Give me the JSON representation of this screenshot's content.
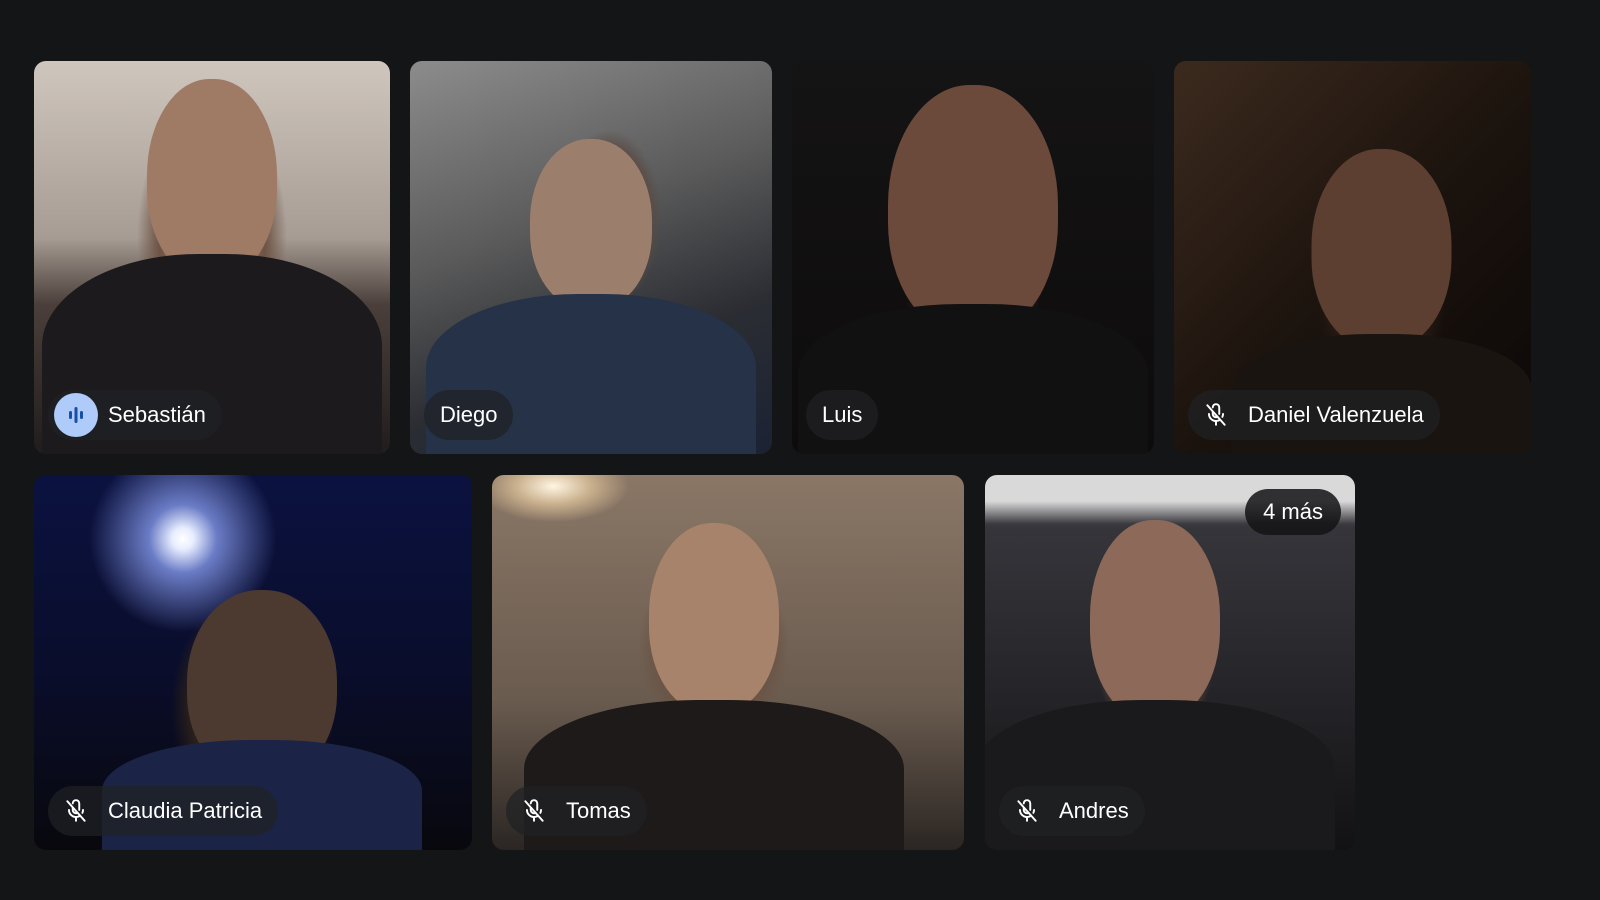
{
  "meeting": {
    "participants": [
      {
        "name": "Sebastián",
        "mic": "speaking",
        "icon": "audio-wave-icon"
      },
      {
        "name": "Diego",
        "mic": "none"
      },
      {
        "name": "Luis",
        "mic": "none"
      },
      {
        "name": "Daniel Valenzuela",
        "mic": "muted",
        "icon": "mic-off-icon"
      },
      {
        "name": "Claudia Patricia",
        "mic": "muted",
        "icon": "mic-off-icon"
      },
      {
        "name": "Tomas",
        "mic": "muted",
        "icon": "mic-off-icon"
      },
      {
        "name": "Andres",
        "mic": "muted",
        "icon": "mic-off-icon"
      }
    ],
    "more_participants_label": "4 más"
  },
  "colors": {
    "background": "#141517",
    "speaking_indicator": "#aecbfa",
    "chip_text": "#ffffff"
  }
}
